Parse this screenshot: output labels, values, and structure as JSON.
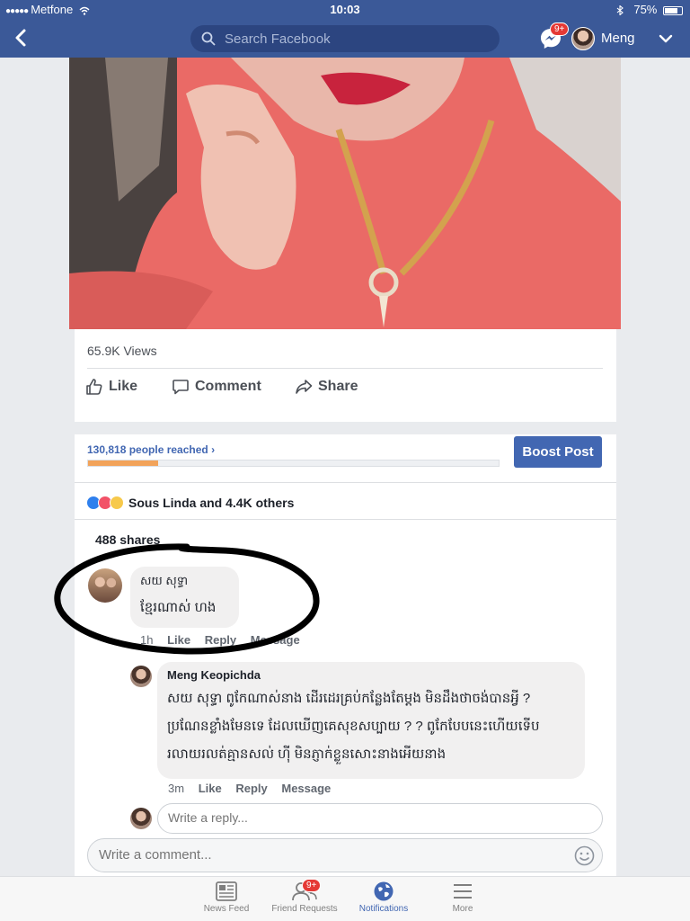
{
  "status": {
    "carrier": "Metfone",
    "time": "10:03",
    "battery": "75%"
  },
  "header": {
    "search_placeholder": "Search Facebook",
    "messenger_badge": "9+",
    "user_name": "Meng"
  },
  "post": {
    "views": "65.9K Views",
    "actions": {
      "like": "Like",
      "comment": "Comment",
      "share": "Share"
    },
    "reach": "130,818 people reached",
    "reach_progress_fraction": 0.17,
    "boost_label": "Boost Post",
    "reactions_text": "Sous Linda and 4.4K others",
    "shares": "488 shares"
  },
  "comments": [
    {
      "author": "សយ សុទ្ធា",
      "text": "ខ្មែរណាស់ ហង",
      "time": "1h",
      "actions": [
        "Like",
        "Reply",
        "Message"
      ]
    }
  ],
  "reply": {
    "author": "Meng Keopichda",
    "lines": [
      "សយ សុទ្ធា ពូកែណាស់នាង ដើរដេរគ្រប់កន្លែងតែម្តង មិនដឹងថាចង់បានអ្វី ?",
      "ប្រណែនខ្លាំងមែនទេ ដែលឃើញគេសុខសប្បាយ ? ? ពូកែបែបនេះហើយទើប",
      "រលាយរលត់គ្មានសល់ ហ៊ី មិនភ្ញាក់ខ្លួនសោះនាងអើយនាង"
    ],
    "time": "3m",
    "actions": [
      "Like",
      "Reply",
      "Message"
    ]
  },
  "reply_placeholder": "Write a reply...",
  "comment_placeholder": "Write a comment...",
  "bottom_nav": [
    {
      "label": "News Feed",
      "icon": "news-feed-icon"
    },
    {
      "label": "Friend Requests",
      "icon": "friends-icon",
      "badge": "9+"
    },
    {
      "label": "Notifications",
      "icon": "globe-icon",
      "active": true
    },
    {
      "label": "More",
      "icon": "menu-icon"
    }
  ],
  "colors": {
    "brand": "#3b5998",
    "link": "#4267b2",
    "progress": "#f2a35a",
    "badge": "#e53935"
  }
}
